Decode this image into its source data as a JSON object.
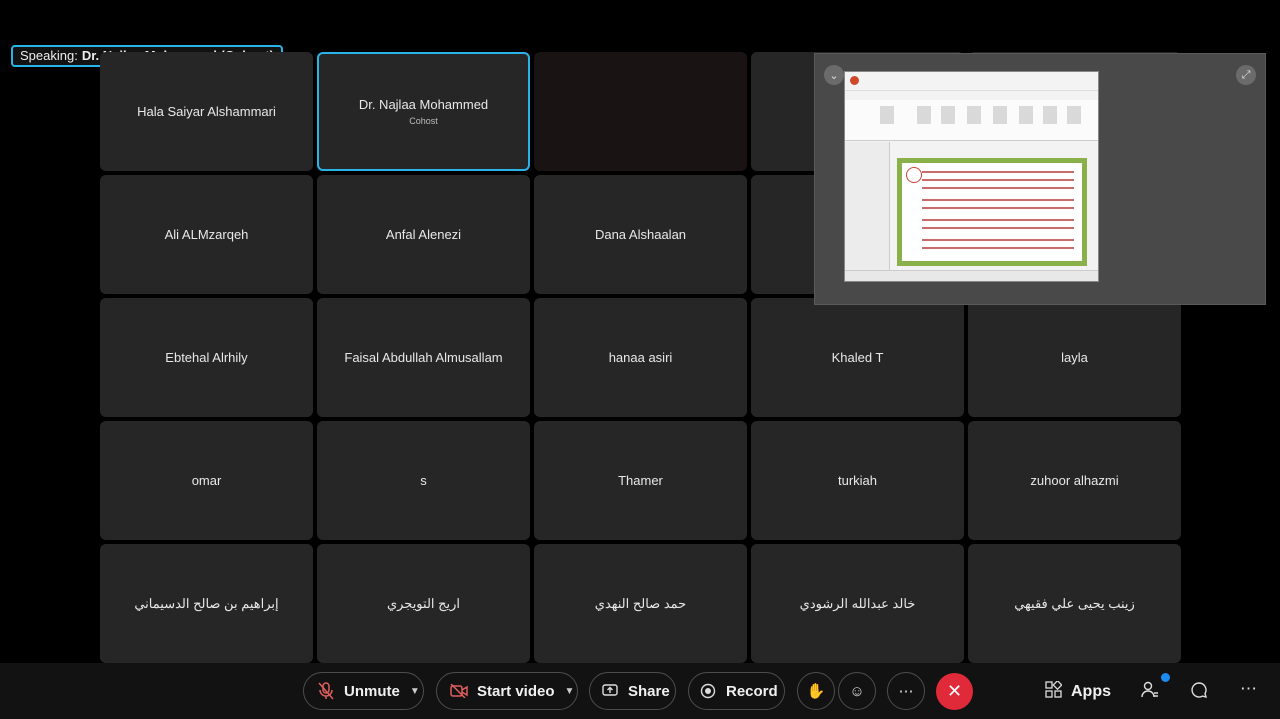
{
  "speaking": {
    "label": "Speaking:",
    "name": "Dr. Najlaa Mohammed (Cohost)"
  },
  "participants": [
    {
      "name": "Hala Saiyar Alshammari",
      "role": ""
    },
    {
      "name": "Dr. Najlaa Mohammed",
      "role": "Cohost",
      "active": true
    },
    {
      "name": "",
      "role": "",
      "video": true
    },
    {
      "name": "",
      "role": ""
    },
    {
      "name": "",
      "role": ""
    },
    {
      "name": "Ali ALMzarqeh",
      "role": ""
    },
    {
      "name": "Anfal Alenezi",
      "role": ""
    },
    {
      "name": "Dana Alshaalan",
      "role": ""
    },
    {
      "name": "",
      "role": ""
    },
    {
      "name": "",
      "role": ""
    },
    {
      "name": "Ebtehal Alrhily",
      "role": ""
    },
    {
      "name": "Faisal Abdullah Almusallam",
      "role": ""
    },
    {
      "name": "hanaa asiri",
      "role": ""
    },
    {
      "name": "Khaled T",
      "role": ""
    },
    {
      "name": "layla",
      "role": ""
    },
    {
      "name": "omar",
      "role": ""
    },
    {
      "name": "s",
      "role": ""
    },
    {
      "name": "Thamer",
      "role": ""
    },
    {
      "name": "turkiah",
      "role": ""
    },
    {
      "name": "zuhoor alhazmi",
      "role": ""
    },
    {
      "name": "إبراهيم بن صالح الدسيماني",
      "role": ""
    },
    {
      "name": "اريج التويجري",
      "role": ""
    },
    {
      "name": "حمد صالح النهدي",
      "role": ""
    },
    {
      "name": "خالد عبدالله الرشودي",
      "role": ""
    },
    {
      "name": "زينب يحيى علي فقيهي",
      "role": ""
    }
  ],
  "toolbar": {
    "unmute": "Unmute",
    "start_video": "Start video",
    "share": "Share",
    "record": "Record",
    "apps": "Apps"
  },
  "colors": {
    "accent": "#2ab3e8",
    "end_call": "#e02a3a",
    "tile": "#262626",
    "notification": "#1d8cf0"
  }
}
